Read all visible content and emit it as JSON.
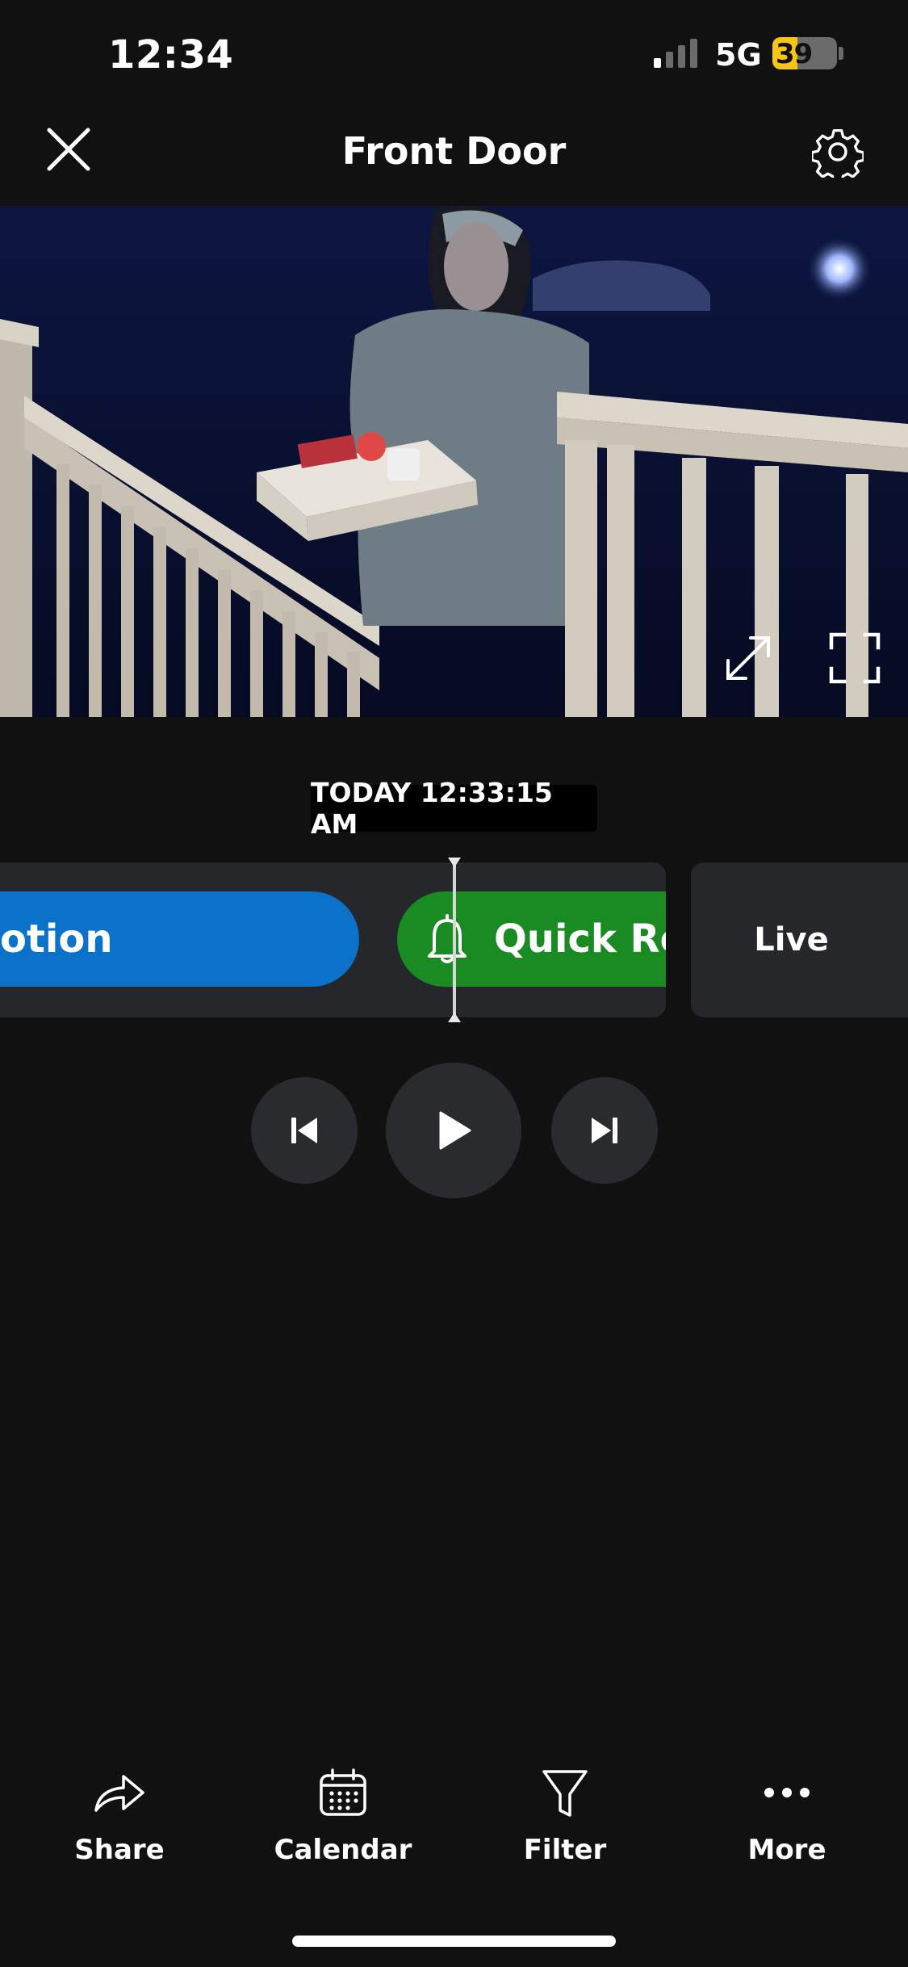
{
  "status_bar": {
    "time": "12:34",
    "network": "5G",
    "battery_percent": "39",
    "battery_level": 0.39,
    "battery_color": "#f5c518"
  },
  "header": {
    "title": "Front Door",
    "close_icon": "close-icon",
    "settings_icon": "gear-icon"
  },
  "video": {
    "expand_icon": "expand-icon",
    "fullscreen_icon": "fullscreen-icon"
  },
  "timestamp": "TODAY 12:33:15 AM",
  "timeline": {
    "events": [
      {
        "label": "Motion",
        "visible_label": "otion",
        "color": "#0a73c9"
      },
      {
        "label": "Quick Rep",
        "icon": "bell-icon",
        "color": "#1a8a22"
      }
    ],
    "live_label": "Live"
  },
  "playback": {
    "prev_icon": "skip-previous-icon",
    "play_icon": "play-icon",
    "next_icon": "skip-next-icon"
  },
  "toolbar": {
    "share_label": "Share",
    "calendar_label": "Calendar",
    "filter_label": "Filter",
    "more_label": "More"
  }
}
